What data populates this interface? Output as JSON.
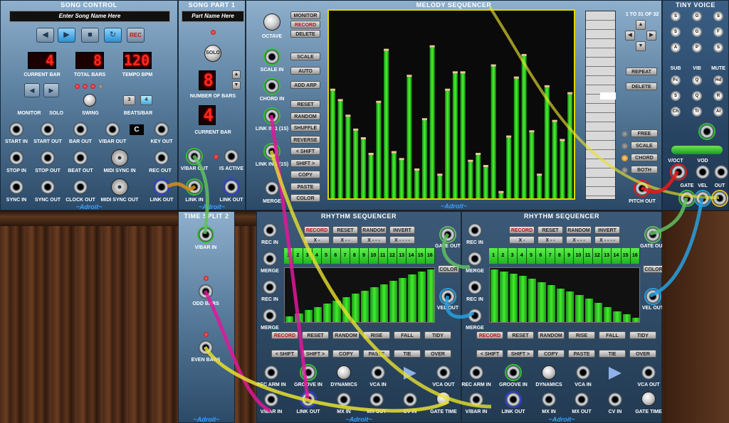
{
  "song_control": {
    "title": "SONG CONTROL",
    "song_name_placeholder": "Enter Song Name Here",
    "transport": {
      "rec_label": "REC"
    },
    "current_bar": "4",
    "total_bars": "8",
    "tempo_bpm": "120",
    "current_bar_label": "CURRENT BAR",
    "total_bars_label": "TOTAL BARS",
    "tempo_label": "TEMPO BPM",
    "monitor_label": "MONITOR",
    "solo_label": "SOLO",
    "swing_label": "SWING",
    "beats_bar_label": "BEATS/BAR",
    "beats_options": [
      "3",
      "4"
    ],
    "key_value": "C",
    "jacks_row1": [
      "START IN",
      "START OUT",
      "BAR OUT",
      "V/BAR OUT",
      "KEY OUT"
    ],
    "jacks_row2": [
      "STOP IN",
      "STOP OUT",
      "BEAT OUT",
      "MIDI SYNC IN",
      "REC OUT"
    ],
    "jacks_row3": [
      "SYNC IN",
      "SYNC OUT",
      "CLOCK OUT",
      "MIDI SYNC OUT",
      "LINK OUT"
    ],
    "brand": "~Adroit~"
  },
  "song_part": {
    "title": "SONG PART 1",
    "part_name_placeholder": "Part Name Here",
    "solo_label": "SOLO",
    "number_of_bars": "8",
    "number_of_bars_label": "NUMBER OF BARS",
    "current_bar": "4",
    "current_bar_label": "CURRENT BAR",
    "vbar_out": "V/BAR OUT",
    "is_active": "IS ACTIVE",
    "link_in": "LINK IN",
    "link_out": "LINK OUT",
    "brand": "~Adroit~"
  },
  "time_split": {
    "title": "TIME SPLIT 2",
    "vbar_in": "V/BAR IN",
    "odd_bars": "ODD BARS",
    "even_bars": "EVEN BARS",
    "brand": "~Adroit~"
  },
  "melody_sequencer": {
    "title": "MELODY SEQUENCER",
    "octave_label": "OCTAVE",
    "scale_in": "SCALE IN",
    "chord_in": "CHORD IN",
    "link_in_1": "LINK IN 1 (1S)",
    "link_in_2": "LINK IN 2 (1S)",
    "merge": "MERGE",
    "buttons_top": [
      "MONITOR",
      "RECORD",
      "DELETE"
    ],
    "buttons_mid": [
      "SCALE",
      "AUTO",
      "ADD ARP"
    ],
    "buttons_list": [
      "RESET",
      "RANDOM",
      "SHUFFLE",
      "REVERSE",
      "< SHIFT",
      "SHIFT >",
      "COPY",
      "PASTE",
      "COLOR"
    ],
    "range_text": "1 TO 31 OF 32",
    "repeat_label": "REPEAT",
    "delete_label": "DELETE",
    "modes": [
      "FREE",
      "SCALE",
      "CHORD",
      "BOTH"
    ],
    "pitch_out": "PITCH OUT",
    "brand": "~Adroit~",
    "steps": [
      0.62,
      0.56,
      0.47,
      0.39,
      0.34,
      0.25,
      0.55,
      0.85,
      0.26,
      0.22,
      0.7,
      0.16,
      0.45,
      0.87,
      0.13,
      0.62,
      0.72,
      0.72,
      0.21,
      0.25,
      0.18,
      0.76,
      0.03,
      0.35,
      0.69,
      0.82,
      0.38,
      0.13,
      0.64,
      0.44,
      0.33,
      0.6
    ]
  },
  "rhythm_sequencer_1": {
    "title": "RHYTHM SEQUENCER",
    "top_buttons": [
      "RECORD",
      "RESET",
      "RANDOM",
      "INVERT"
    ],
    "x_buttons": [
      "X -",
      "X - -",
      "X - - -",
      "X - - - -"
    ],
    "steps": [
      "1",
      "2",
      "3",
      "4",
      "5",
      "6",
      "7",
      "8",
      "9",
      "10",
      "11",
      "12",
      "13",
      "14",
      "15",
      "16"
    ],
    "velocities": [
      0.1,
      0.16,
      0.22,
      0.28,
      0.34,
      0.4,
      0.46,
      0.52,
      0.58,
      0.64,
      0.7,
      0.76,
      0.82,
      0.88,
      0.94,
      0.98
    ],
    "rec_in": "REC IN",
    "merge": "MERGE",
    "gate_out": "GATE OUT",
    "vel_out": "VEL OUT",
    "color": "COLOR",
    "buttons_row1": [
      "RECORD",
      "RESET",
      "RANDOM",
      "RISE",
      "FALL",
      "TIDY"
    ],
    "buttons_row2": [
      "< SHIFT",
      "SHIFT >",
      "COPY",
      "PASTE",
      "TIE",
      "OVER"
    ],
    "bottom_row1": [
      "REC ARM IN",
      "GROOVE IN",
      "DYNAMICS",
      "VCA IN",
      "VCA OUT"
    ],
    "bottom_row2": [
      "V/BAR IN",
      "LINK OUT",
      "MX IN",
      "MX OUT",
      "CV IN",
      "GATE TIME"
    ],
    "brand": "~Adroit~"
  },
  "rhythm_sequencer_2": {
    "title": "RHYTHM SEQUENCER",
    "top_buttons": [
      "RECORD",
      "RESET",
      "RANDOM",
      "INVERT"
    ],
    "x_buttons": [
      "X -",
      "X - -",
      "X - - -",
      "X - - - -"
    ],
    "steps": [
      "1",
      "2",
      "3",
      "4",
      "5",
      "6",
      "7",
      "8",
      "9",
      "10",
      "11",
      "12",
      "13",
      "14",
      "15",
      "16"
    ],
    "velocities": [
      0.98,
      0.94,
      0.9,
      0.86,
      0.8,
      0.74,
      0.68,
      0.62,
      0.56,
      0.5,
      0.44,
      0.36,
      0.28,
      0.2,
      0.14,
      0.08
    ],
    "rec_in": "REC IN",
    "merge": "MERGE",
    "gate_out": "GATE OUT",
    "vel_out": "VEL OUT",
    "color": "COLOR",
    "buttons_row1": [
      "RECORD",
      "RESET",
      "RANDOM",
      "RISE",
      "FALL",
      "TIDY"
    ],
    "buttons_row2": [
      "< SHIFT",
      "SHIFT >",
      "COPY",
      "PASTE",
      "TIE",
      "OVER"
    ],
    "bottom_row1": [
      "REC ARM IN",
      "GROOVE IN",
      "DYNAMICS",
      "VCA IN",
      "VCA OUT"
    ],
    "bottom_row2": [
      "V/BAR IN",
      "LINK OUT",
      "MX IN",
      "MX OUT",
      "CV IN",
      "GATE TIME"
    ],
    "brand": "~Adroit~"
  },
  "tiny_voice": {
    "title": "TINY VOICE",
    "labels_row": [
      "SUB",
      "VIB",
      "MUTE"
    ],
    "voct": "V/OCT",
    "vod": "VOD",
    "gate": "GATE",
    "vel": "VEL",
    "out": "OUT",
    "knob_letters": [
      "S",
      "G",
      "S",
      "S",
      "G",
      "F",
      "A",
      "P",
      "S",
      "Fc",
      "Q",
      "Hd",
      "S",
      "Q",
      "R",
      "Ch",
      "Tr",
      "AI",
      "NI",
      "OI"
    ]
  },
  "colors": {
    "accent_green": "#3cdc2c",
    "cable_pink": "#e0189a",
    "cable_yellow": "#e8e030",
    "cable_green": "#60c060",
    "cable_blue": "#28a0e0",
    "cable_orange": "#d08c1c",
    "cable_red": "#e01c1c"
  }
}
